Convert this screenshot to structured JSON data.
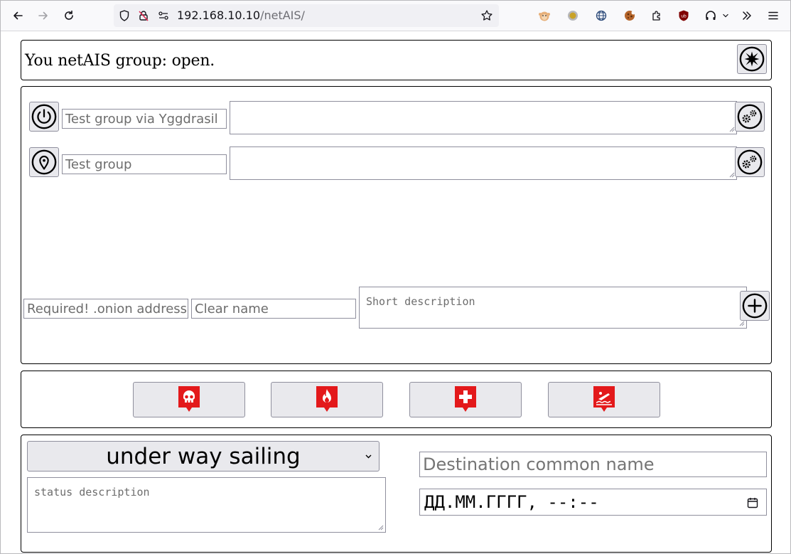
{
  "browser": {
    "url_host": "192.168.10.10",
    "url_path": "/netAIS/",
    "icons": [
      "back-arrow-icon",
      "forward-arrow-icon",
      "reload-icon",
      "shield-icon",
      "insecure-lock-icon",
      "permissions-icon",
      "bookmark-star-icon",
      "extension-icons",
      "extensions-puzzle-icon",
      "ublock-icon",
      "headphones-icon",
      "overflow-chevrons-icon",
      "hamburger-menu-icon"
    ]
  },
  "header": {
    "status_text": "You netAIS group: open.",
    "exit_icon": "star-burst-icon"
  },
  "groups": [
    {
      "icon": "power-icon",
      "name_value": "Test group via Yggdrasil",
      "settings_icon": "gears-icon"
    },
    {
      "icon": "location-pin-icon",
      "name_value": "Test group",
      "settings_icon": "gears-icon"
    }
  ],
  "new_group": {
    "onion_placeholder": "Required! .onion address",
    "name_placeholder": "Clear name",
    "description_placeholder": "Short description",
    "add_icon": "plus-circle-icon"
  },
  "alarms": [
    {
      "name": "man-overboard-alarm",
      "icon": "skull-icon"
    },
    {
      "name": "fire-alarm",
      "icon": "fire-icon"
    },
    {
      "name": "medical-alarm",
      "icon": "cross-icon"
    },
    {
      "name": "sinking-alarm",
      "icon": "sinking-icon"
    }
  ],
  "alarm_color": "#e3191b",
  "status": {
    "selected": "under way sailing",
    "description_placeholder": "status description",
    "destination_placeholder": "Destination common name",
    "datetime_placeholder": "ДД.ММ.ГГГГ, --:--"
  }
}
